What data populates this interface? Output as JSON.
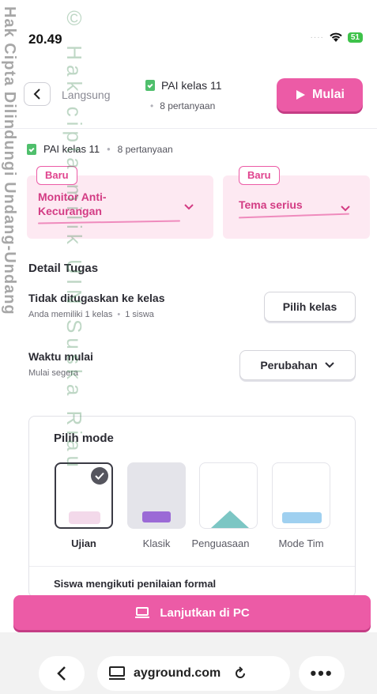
{
  "status": {
    "time": "20.49",
    "battery": "51"
  },
  "header": {
    "back_sub": "Langsung",
    "title": "PAI kelas 11",
    "count": "8 pertanyaan",
    "start_label": "Mulai"
  },
  "info": {
    "title": "PAI kelas 11",
    "count": "8 pertanyaan"
  },
  "cards": [
    {
      "badge": "Baru",
      "line1": "Monitor Anti-",
      "line2": "Kecurangan"
    },
    {
      "badge": "Baru",
      "line1": "Tema serius"
    }
  ],
  "detail": {
    "section_title": "Detail Tugas",
    "assign_title": "Tidak ditugaskan ke kelas",
    "assign_sub1": "Anda memiliki 1 kelas",
    "assign_sub2": "1 siswa",
    "assign_button": "Pilih kelas",
    "start_title": "Waktu mulai",
    "start_sub": "Mulai segera",
    "start_button": "Perubahan"
  },
  "mode": {
    "title": "Pilih mode",
    "options": [
      {
        "label": "Ujian",
        "selected": true
      },
      {
        "label": "Klasik"
      },
      {
        "label": "Penguasaan"
      },
      {
        "label": "Mode Tim"
      }
    ],
    "formal_text": "Siswa mengikuti penilaian formal"
  },
  "cta": {
    "label": "Lanjutkan di PC"
  },
  "browser": {
    "url": "ayground.com"
  },
  "watermark": {
    "line1": "Hak Cipta Dilindungi Undang-Undang",
    "line2": "© Hak cipta milik UIN Suska Riau"
  },
  "colors": {
    "accent": "#ec5ba6",
    "accent_light": "#fde9f2",
    "green": "#4fbf6c"
  }
}
